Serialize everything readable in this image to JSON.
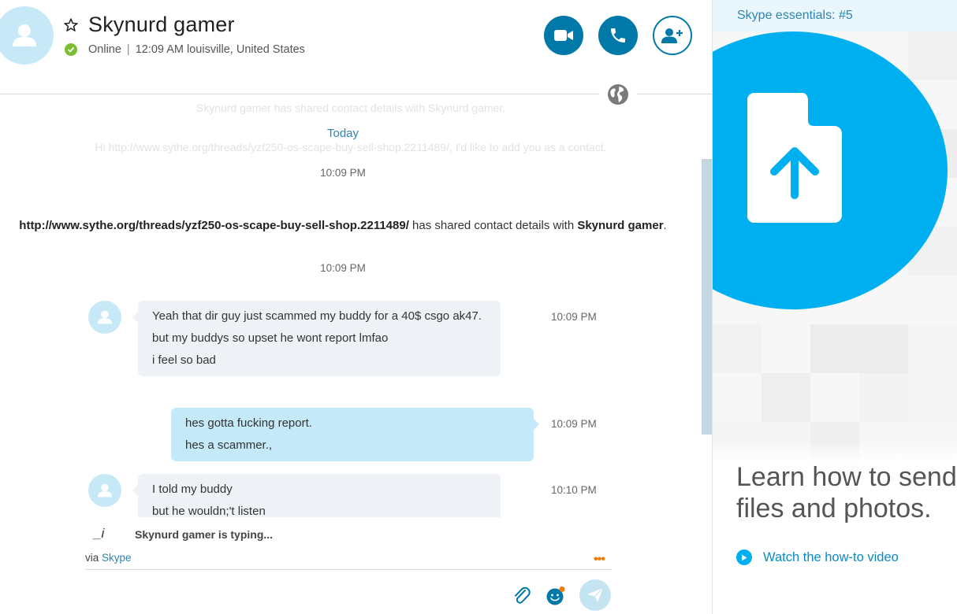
{
  "header": {
    "contact_name": "Skynurd gamer",
    "status": "Online",
    "separator": "|",
    "local_time": "12:09 AM",
    "location": "louisville, United States"
  },
  "history": {
    "faded_top": "Skynurd gamer has shared contact details with Skynurd gamer.",
    "day_label": "Today",
    "faded_request": "Hi http://www.sythe.org/threads/yzf250-os-scape-buy-sell-shop.2211489/, I'd like to add you as a contact.",
    "timestamp_1": "10:09 PM",
    "shared_sender": "http://www.sythe.org/threads/yzf250-os-scape-buy-sell-shop.2211489/",
    "shared_text": " has shared contact details with ",
    "shared_target": "Skynurd gamer",
    "shared_end": ".",
    "timestamp_2": "10:09 PM"
  },
  "messages": [
    {
      "direction": "incoming",
      "time": "10:09 PM",
      "lines": [
        "Yeah that dir guy just scammed my buddy for a 40$ csgo ak47.",
        "but my buddys so upset he wont report lmfao",
        "i feel so bad"
      ]
    },
    {
      "direction": "outgoing",
      "time": "10:09 PM",
      "lines": [
        "hes gotta fucking report.",
        "hes a scammer.,"
      ]
    },
    {
      "direction": "incoming",
      "time": "10:10 PM",
      "lines": [
        "I told my buddy",
        "but he wouldn;'t listen"
      ]
    }
  ],
  "compose": {
    "typing_icon": "_i",
    "typing_text": "Skynurd gamer is typing...",
    "via_label": "via",
    "via_service": "Skype",
    "more_options": "•••"
  },
  "essentials": {
    "title": "Skype essentials: #5",
    "heading_line1": "Learn how to send",
    "heading_line2": "files and photos.",
    "watch_label": "Watch the how-to video"
  },
  "icons": {
    "star": "star-icon",
    "presence": "check-icon",
    "video": "video-camera-icon",
    "call": "phone-icon",
    "add_contact": "add-person-icon",
    "globe": "globe-icon",
    "attach": "paperclip-icon",
    "emoji": "emoticon-icon",
    "send": "send-icon",
    "play": "play-icon",
    "file_upload": "file-upload-icon"
  },
  "colors": {
    "accent": "#0078a8",
    "skype_blue": "#00aff0",
    "presence_online": "#7cbe31",
    "incoming_bubble": "#eef2f6",
    "outgoing_bubble": "#c4e9f8",
    "more_dots": "#f27a00"
  }
}
